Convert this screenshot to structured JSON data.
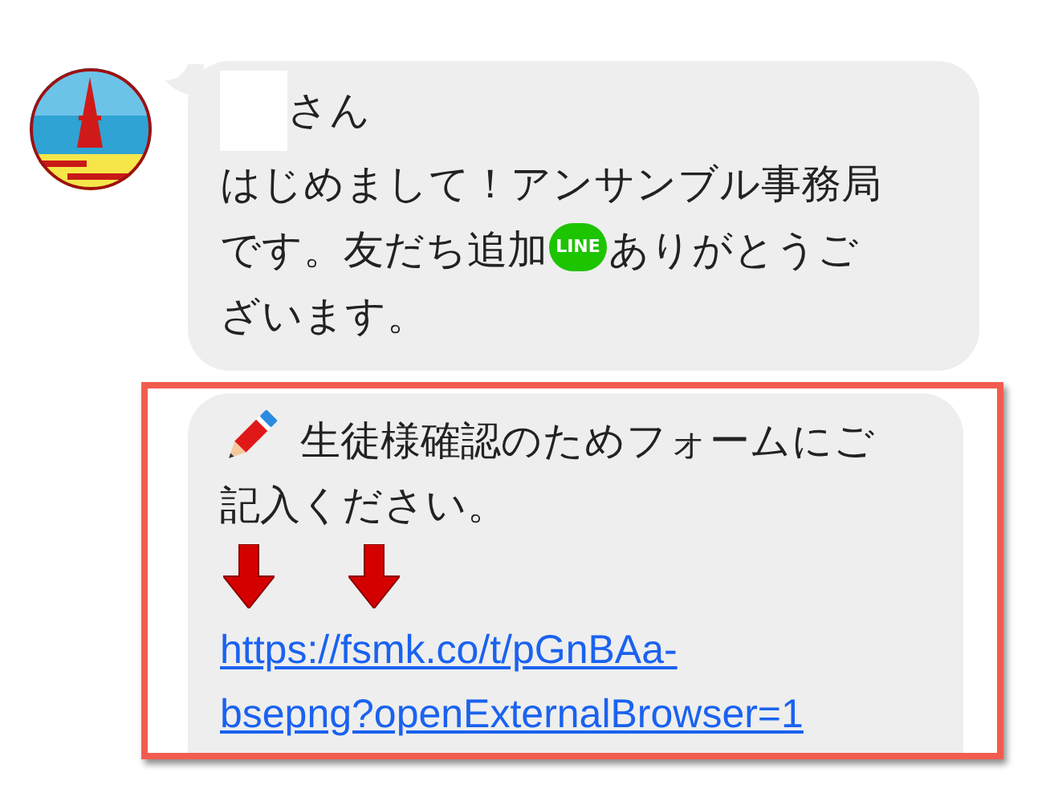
{
  "messages": [
    {
      "kind": "greeting",
      "name_redacted": true,
      "salutation": "さん",
      "line_1": "はじめまして！アンサンブル事務局",
      "text_before_icon": "です。友だち追加",
      "icon_label": "LINE",
      "text_after_icon": "ありがとうご",
      "line_3": "ざいます。"
    },
    {
      "kind": "form",
      "highlighted": true,
      "text_line_1": "生徒様確認のためフォームにご",
      "text_line_2": "記入ください。",
      "arrows": [
        {
          "kind": "down"
        },
        {
          "kind": "down"
        }
      ],
      "link": "https://fsmk.co/t/pGnBAa-bsepng?openExternalBrowser=1"
    }
  ]
}
